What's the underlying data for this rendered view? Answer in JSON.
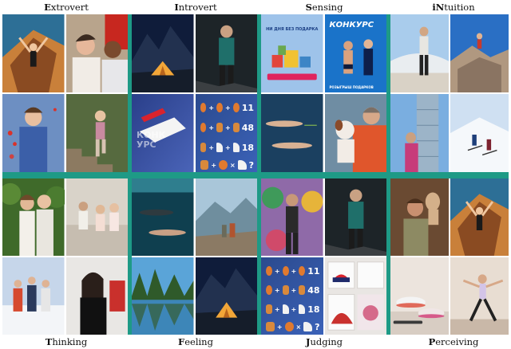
{
  "labels": {
    "extrovert": {
      "first": "E",
      "rest": "xtrovert"
    },
    "introvert": {
      "first": "I",
      "rest": "ntrovert"
    },
    "sensing": {
      "first": "S",
      "rest": "ensing"
    },
    "intuition": {
      "first": "iN",
      "rest": "tuition"
    },
    "thinking": {
      "first": "T",
      "rest": "hinking"
    },
    "feeling": {
      "first": "F",
      "rest": "eeling"
    },
    "judging": {
      "first": "J",
      "rest": "udging"
    },
    "perceiving": {
      "first": "P",
      "rest": "erceiving"
    }
  },
  "promo": {
    "gift_banner": "НИ ДНЯ БЕЗ ПОДАРКА",
    "konkurs": "КОНКУРС",
    "konkurs_sub": "РОЗЫГРЫШ ПОДАРКОВ",
    "konk_logo": "КОНКУРС"
  },
  "puzzle": {
    "values": [
      "11",
      "48",
      "18",
      "?"
    ],
    "eq": "="
  },
  "colors": {
    "divider": "#1e9a86",
    "night": "#0f1c3a",
    "tent": "#f2a638"
  }
}
